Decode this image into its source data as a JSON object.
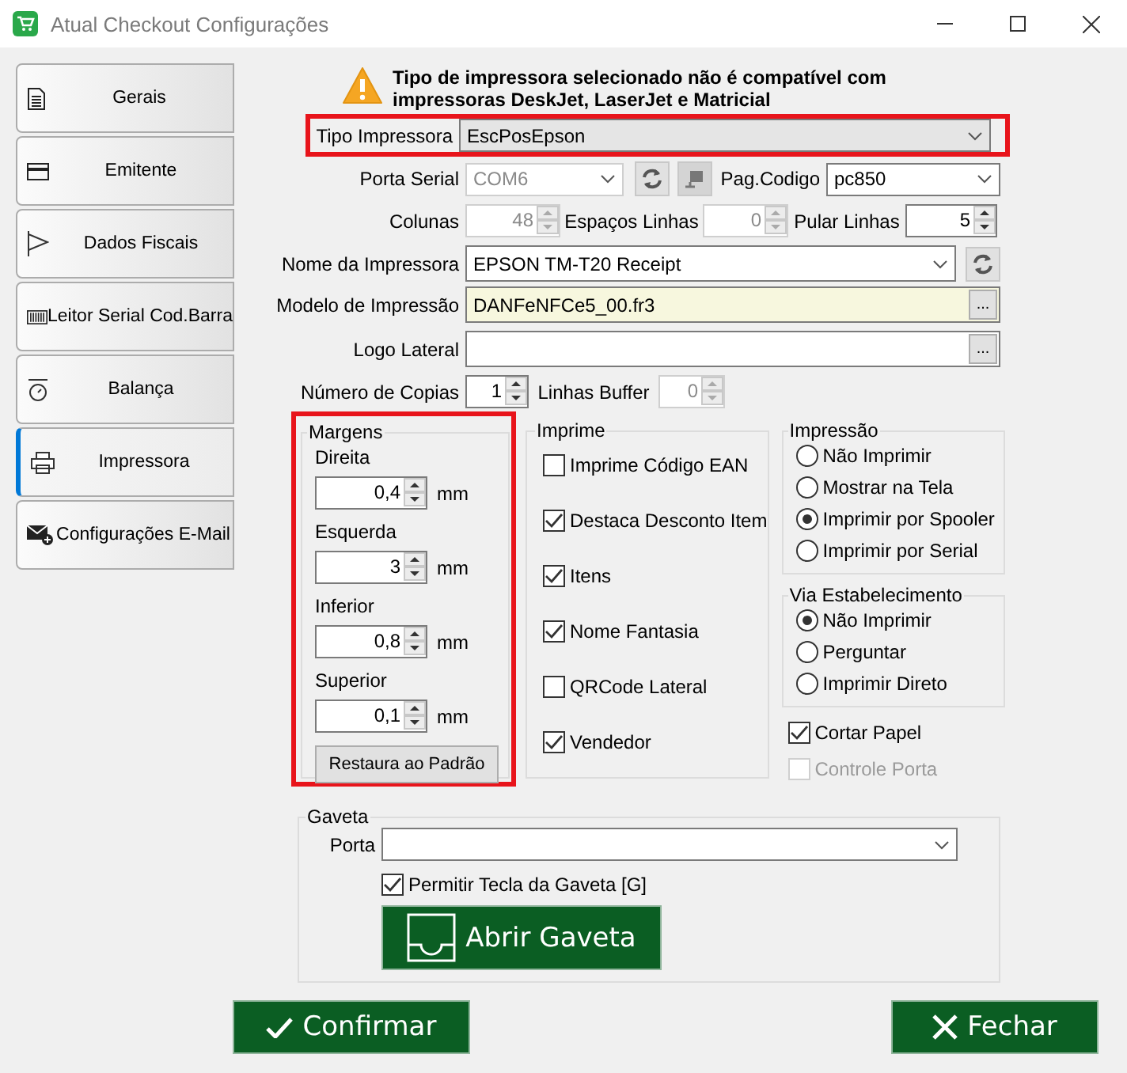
{
  "window": {
    "title": "Atual Checkout Configurações"
  },
  "sidebar": {
    "items": [
      {
        "label": "Gerais",
        "selected": false
      },
      {
        "label": "Emitente",
        "selected": false
      },
      {
        "label": "Dados Fiscais",
        "selected": false
      },
      {
        "label": "Leitor Serial Cod.Barra",
        "selected": false
      },
      {
        "label": "Balança",
        "selected": false
      },
      {
        "label": "Impressora",
        "selected": true
      },
      {
        "label": "Configurações E-Mail",
        "selected": false
      }
    ]
  },
  "warning": "Tipo de impressora selecionado não é compatível com impressoras DeskJet, LaserJet e Matricial",
  "printer_type": {
    "label": "Tipo Impressora",
    "value": "EscPosEpson",
    "highlighted": true
  },
  "serial_port": {
    "label": "Porta Serial",
    "value": "COM6",
    "disabled": true
  },
  "code_page": {
    "label": "Pag.Codigo",
    "value": "pc850"
  },
  "columns": {
    "label": "Colunas",
    "value": "48",
    "disabled": true
  },
  "line_spacing": {
    "label": "Espaços Linhas",
    "value": "0",
    "disabled": true
  },
  "skip_lines": {
    "label": "Pular Linhas",
    "value": "5",
    "disabled": false
  },
  "printer_name": {
    "label": "Nome da Impressora",
    "value": "EPSON TM-T20 Receipt"
  },
  "print_model": {
    "label": "Modelo de Impressão",
    "value": "DANFeNFCe5_00.fr3",
    "button": "..."
  },
  "side_logo": {
    "label": "Logo Lateral",
    "button": "..."
  },
  "copies": {
    "label": "Número de Copias",
    "value": "1",
    "disabled": false
  },
  "buffer_lines": {
    "label": "Linhas Buffer",
    "value": "0",
    "disabled": true
  },
  "margins": {
    "title": "Margens",
    "highlighted": true,
    "reset_button": "Restaura ao Padrão",
    "items": [
      {
        "label": "Direita",
        "value": "0,4",
        "unit": "mm"
      },
      {
        "label": "Esquerda",
        "value": "3",
        "unit": "mm"
      },
      {
        "label": "Inferior",
        "value": "0,8",
        "unit": "mm"
      },
      {
        "label": "Superior",
        "value": "0,1",
        "unit": "mm"
      }
    ]
  },
  "print_options": {
    "title": "Imprime",
    "items": [
      {
        "label": "Imprime Código EAN",
        "checked": false
      },
      {
        "label": "Destaca Desconto Item",
        "checked": true
      },
      {
        "label": "Itens",
        "checked": true
      },
      {
        "label": "Nome Fantasia",
        "checked": true
      },
      {
        "label": "QRCode Lateral",
        "checked": false
      },
      {
        "label": "Vendedor",
        "checked": true
      }
    ]
  },
  "printing": {
    "title": "Impressão",
    "options": [
      {
        "label": "Não Imprimir",
        "selected": false
      },
      {
        "label": "Mostrar na Tela",
        "selected": false
      },
      {
        "label": "Imprimir por Spooler",
        "selected": true
      },
      {
        "label": "Imprimir por Serial",
        "selected": false
      }
    ]
  },
  "store_copy": {
    "title": "Via Estabelecimento",
    "options": [
      {
        "label": "Não Imprimir",
        "selected": true
      },
      {
        "label": "Perguntar",
        "selected": false
      },
      {
        "label": "Imprimir Direto",
        "selected": false
      }
    ]
  },
  "extra_options": [
    {
      "label": "Cortar Papel",
      "checked": true,
      "disabled": false
    },
    {
      "label": "Controle Porta",
      "checked": false,
      "disabled": true
    }
  ],
  "drawer": {
    "title": "Gaveta",
    "port_label": "Porta",
    "allow_key": {
      "label": "Permitir Tecla da Gaveta [G]",
      "checked": true
    },
    "open_button": "Abrir Gaveta"
  },
  "buttons": [
    {
      "label": "Confirmar",
      "kind": "confirm"
    },
    {
      "label": "Fechar",
      "kind": "close"
    }
  ]
}
